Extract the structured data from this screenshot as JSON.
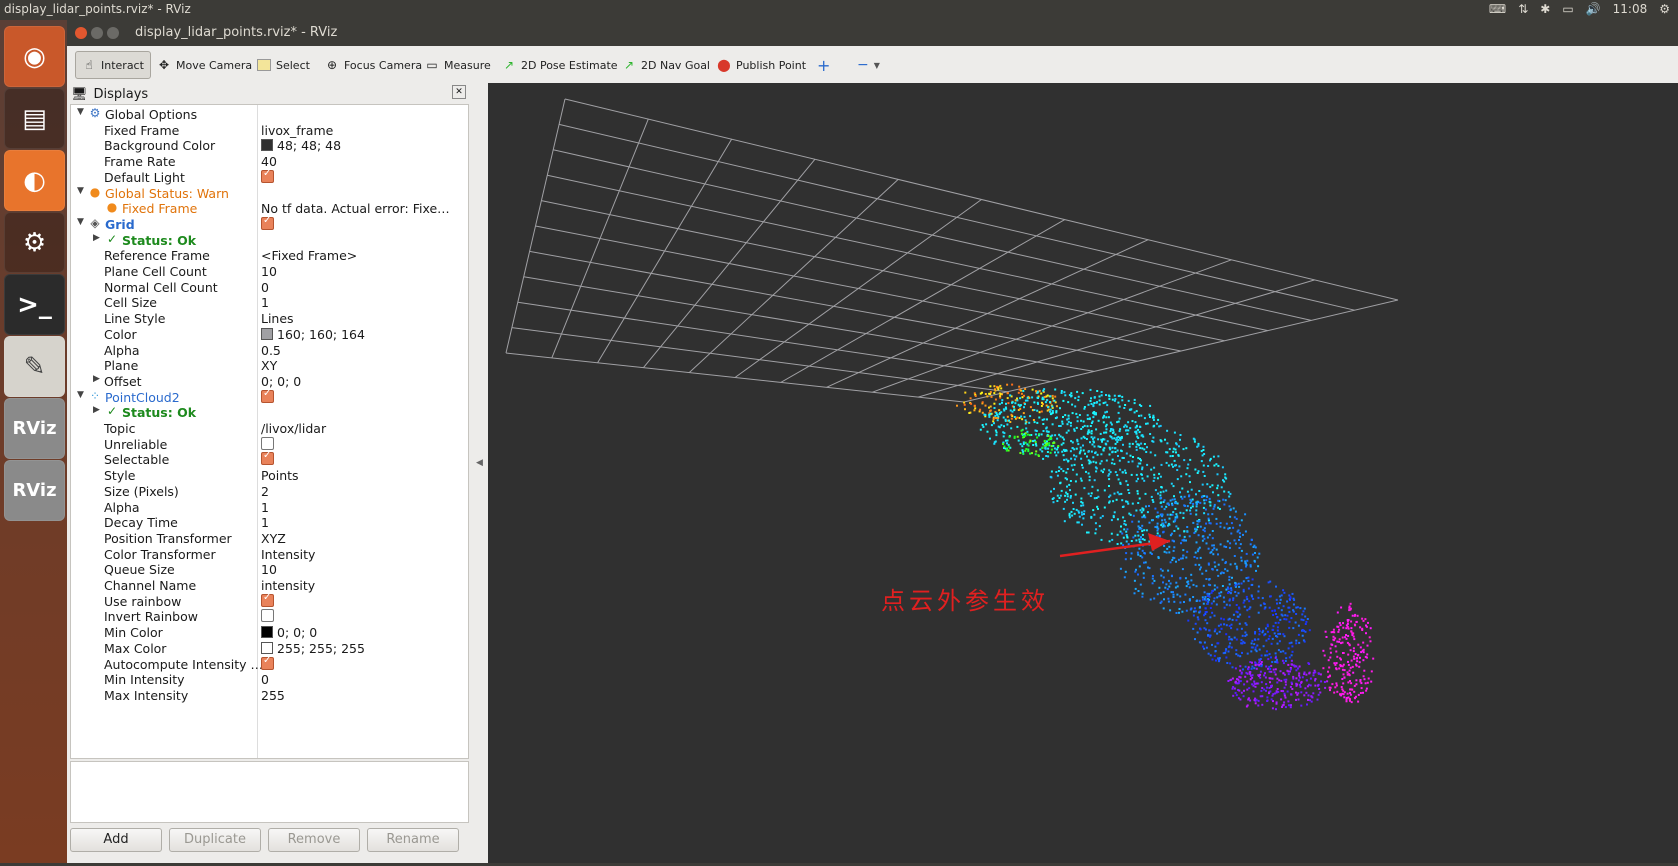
{
  "os_topbar": {
    "title": "display_lidar_points.rviz* - RViz",
    "time": "11:08"
  },
  "launcher": {
    "items": [
      "ubuntu-logo",
      "files",
      "firefox",
      "settings",
      "terminal",
      "text-editor",
      "RViz",
      "RViz"
    ]
  },
  "window": {
    "title": "display_lidar_points.rviz* - RViz"
  },
  "toolbar": {
    "interact": "Interact",
    "move_camera": "Move Camera",
    "select": "Select",
    "focus_camera": "Focus Camera",
    "measure": "Measure",
    "pose_estimate": "2D Pose Estimate",
    "nav_goal": "2D Nav Goal",
    "publish_point": "Publish Point",
    "add_icon": "+",
    "minus_icon": "−"
  },
  "displays_panel": {
    "title": "Displays",
    "rows": [
      {
        "indent": 0,
        "arrow": "▼",
        "icon": "gear",
        "name": "Global Options",
        "value": "",
        "style": ""
      },
      {
        "indent": 1,
        "arrow": "",
        "icon": "",
        "name": "Fixed Frame",
        "value": "livox_frame",
        "style": ""
      },
      {
        "indent": 1,
        "arrow": "",
        "icon": "",
        "name": "Background Color",
        "value": "48; 48; 48",
        "swatch": "#303030",
        "style": ""
      },
      {
        "indent": 1,
        "arrow": "",
        "icon": "",
        "name": "Frame Rate",
        "value": "40",
        "style": ""
      },
      {
        "indent": 1,
        "arrow": "",
        "icon": "",
        "name": "Default Light",
        "checkbox": true,
        "style": ""
      },
      {
        "indent": 0,
        "arrow": "▼",
        "icon": "warn",
        "name": "Global Status: Warn",
        "value": "",
        "style": "warn"
      },
      {
        "indent": 1,
        "arrow": "",
        "icon": "warn",
        "name": "Fixed Frame",
        "value": "No tf data.  Actual error: Fixe…",
        "style": "warn"
      },
      {
        "indent": 0,
        "arrow": "▼",
        "icon": "grid",
        "name": "Grid",
        "checkbox": true,
        "style": "blue"
      },
      {
        "indent": 1,
        "arrow": "▶",
        "icon": "ok",
        "name": "Status: Ok",
        "value": "",
        "style": "ok"
      },
      {
        "indent": 1,
        "arrow": "",
        "icon": "",
        "name": "Reference Frame",
        "value": "<Fixed Frame>",
        "style": ""
      },
      {
        "indent": 1,
        "arrow": "",
        "icon": "",
        "name": "Plane Cell Count",
        "value": "10",
        "style": ""
      },
      {
        "indent": 1,
        "arrow": "",
        "icon": "",
        "name": "Normal Cell Count",
        "value": "0",
        "style": ""
      },
      {
        "indent": 1,
        "arrow": "",
        "icon": "",
        "name": "Cell Size",
        "value": "1",
        "style": ""
      },
      {
        "indent": 1,
        "arrow": "",
        "icon": "",
        "name": "Line Style",
        "value": "Lines",
        "style": ""
      },
      {
        "indent": 1,
        "arrow": "",
        "icon": "",
        "name": "Color",
        "value": "160; 160; 164",
        "swatch": "#a0a0a4",
        "style": ""
      },
      {
        "indent": 1,
        "arrow": "",
        "icon": "",
        "name": "Alpha",
        "value": "0.5",
        "style": ""
      },
      {
        "indent": 1,
        "arrow": "",
        "icon": "",
        "name": "Plane",
        "value": "XY",
        "style": ""
      },
      {
        "indent": 1,
        "arrow": "▶",
        "icon": "",
        "name": "Offset",
        "value": "0; 0; 0",
        "style": ""
      },
      {
        "indent": 0,
        "arrow": "▼",
        "icon": "cloud",
        "name": "PointCloud2",
        "checkbox": true,
        "style": "bluel"
      },
      {
        "indent": 1,
        "arrow": "▶",
        "icon": "ok",
        "name": "Status: Ok",
        "value": "",
        "style": "ok"
      },
      {
        "indent": 1,
        "arrow": "",
        "icon": "",
        "name": "Topic",
        "value": "/livox/lidar",
        "style": ""
      },
      {
        "indent": 1,
        "arrow": "",
        "icon": "",
        "name": "Unreliable",
        "checkbox": false,
        "style": ""
      },
      {
        "indent": 1,
        "arrow": "",
        "icon": "",
        "name": "Selectable",
        "checkbox": true,
        "style": ""
      },
      {
        "indent": 1,
        "arrow": "",
        "icon": "",
        "name": "Style",
        "value": "Points",
        "style": ""
      },
      {
        "indent": 1,
        "arrow": "",
        "icon": "",
        "name": "Size (Pixels)",
        "value": "2",
        "style": ""
      },
      {
        "indent": 1,
        "arrow": "",
        "icon": "",
        "name": "Alpha",
        "value": "1",
        "style": ""
      },
      {
        "indent": 1,
        "arrow": "",
        "icon": "",
        "name": "Decay Time",
        "value": "1",
        "style": ""
      },
      {
        "indent": 1,
        "arrow": "",
        "icon": "",
        "name": "Position Transformer",
        "value": "XYZ",
        "style": ""
      },
      {
        "indent": 1,
        "arrow": "",
        "icon": "",
        "name": "Color Transformer",
        "value": "Intensity",
        "style": ""
      },
      {
        "indent": 1,
        "arrow": "",
        "icon": "",
        "name": "Queue Size",
        "value": "10",
        "style": ""
      },
      {
        "indent": 1,
        "arrow": "",
        "icon": "",
        "name": "Channel Name",
        "value": "intensity",
        "style": ""
      },
      {
        "indent": 1,
        "arrow": "",
        "icon": "",
        "name": "Use rainbow",
        "checkbox": true,
        "style": ""
      },
      {
        "indent": 1,
        "arrow": "",
        "icon": "",
        "name": "Invert Rainbow",
        "checkbox": false,
        "style": ""
      },
      {
        "indent": 1,
        "arrow": "",
        "icon": "",
        "name": "Min Color",
        "value": "0; 0; 0",
        "swatch": "#000000",
        "style": ""
      },
      {
        "indent": 1,
        "arrow": "",
        "icon": "",
        "name": "Max Color",
        "value": "255; 255; 255",
        "swatch": "#ffffff",
        "style": ""
      },
      {
        "indent": 1,
        "arrow": "",
        "icon": "",
        "name": "Autocompute Intensity …",
        "checkbox": true,
        "style": ""
      },
      {
        "indent": 1,
        "arrow": "",
        "icon": "",
        "name": "Min Intensity",
        "value": "0",
        "style": ""
      },
      {
        "indent": 1,
        "arrow": "",
        "icon": "",
        "name": "Max Intensity",
        "value": "255",
        "style": ""
      }
    ],
    "buttons": {
      "add": "Add",
      "duplicate": "Duplicate",
      "remove": "Remove",
      "rename": "Rename"
    }
  },
  "viewport": {
    "background": "#303030",
    "grid_color": "#a0a0a4",
    "annotation": "点云外参生效",
    "annotation_color": "#e02020"
  }
}
